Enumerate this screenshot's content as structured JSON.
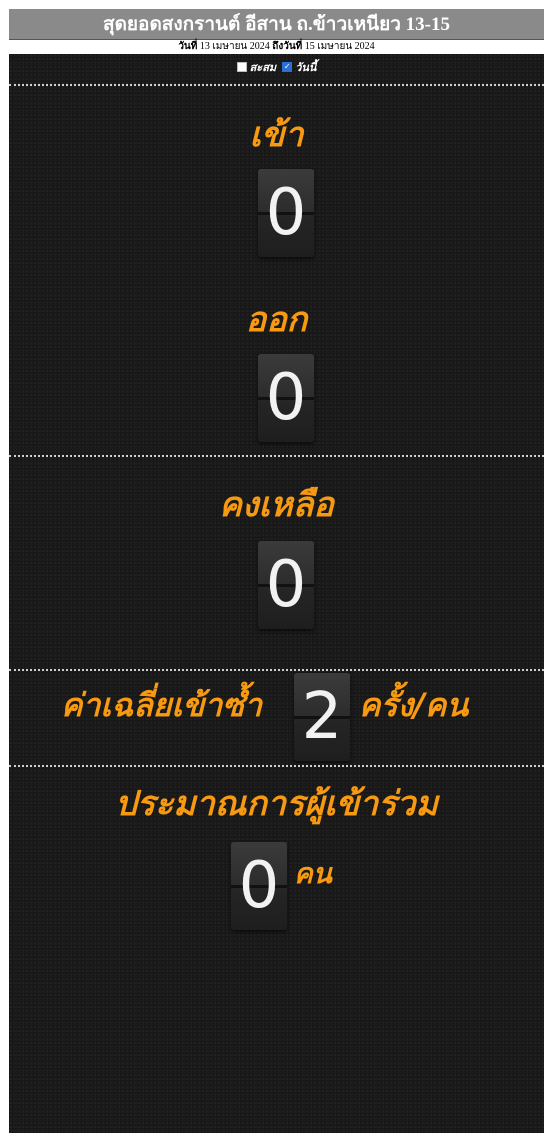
{
  "header": {
    "title": "สุดยอดสงกรานต์ อีสาน ถ.ข้าวเหนียว 13-15",
    "date_prefix": "วันที่",
    "date_start": "13 เมษายน 2024",
    "date_mid": "ถึงวันที่",
    "date_end": "15 เมษายน 2024"
  },
  "toggles": {
    "cumulative": {
      "label": "สะสม",
      "checked": false
    },
    "today": {
      "label": "วันนี้",
      "checked": true
    }
  },
  "stats": {
    "in": {
      "label": "เข้า",
      "value": "0"
    },
    "out": {
      "label": "ออก",
      "value": "0"
    },
    "remaining": {
      "label": "คงเหลือ",
      "value": "0"
    },
    "average": {
      "label": "ค่าเฉลี่ยเข้าซ้ำ",
      "value": "2",
      "unit": "ครั้ง/คน"
    },
    "estimate": {
      "label": "ประมาณการผู้เข้าร่วม",
      "value": "0",
      "unit": "คน"
    }
  },
  "colors": {
    "accent": "#f79a12",
    "background": "#1b1b1b",
    "titlebar": "#8a8a8a",
    "checkbox_checked": "#2a6fd6"
  }
}
